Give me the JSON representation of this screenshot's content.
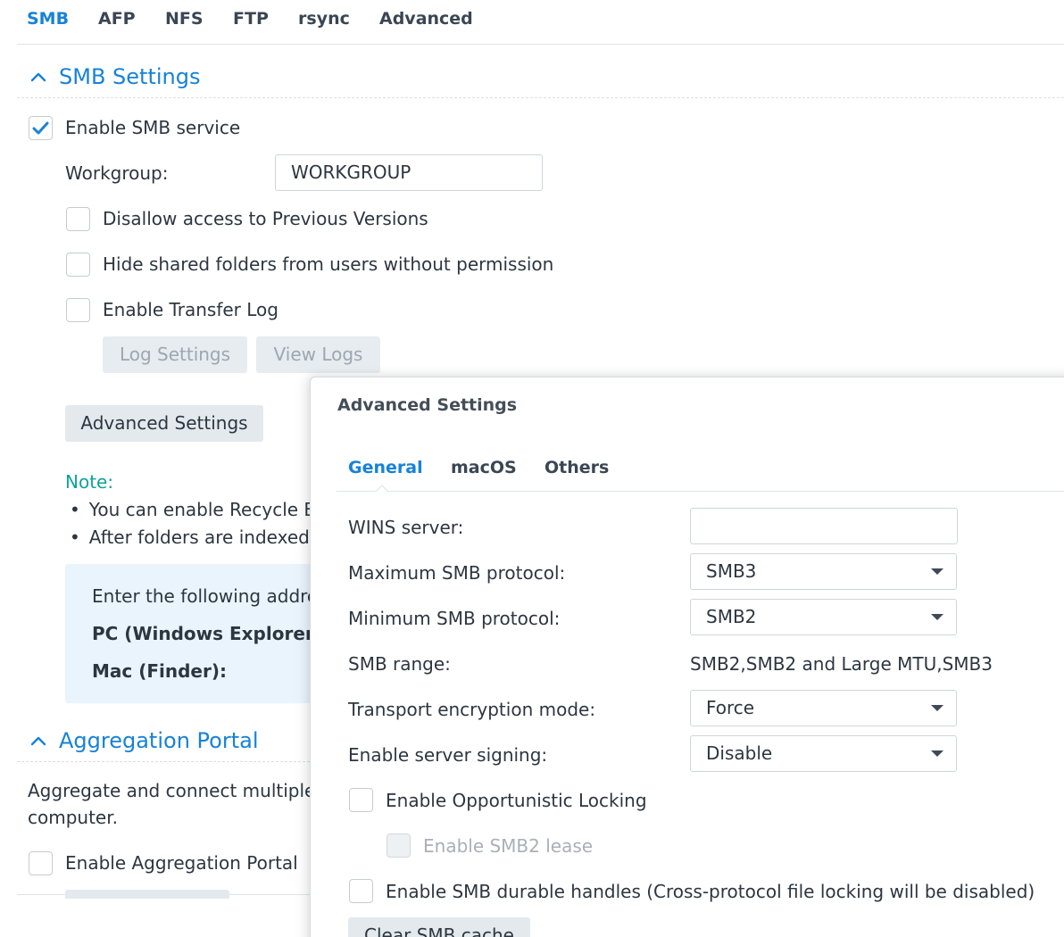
{
  "top_tabs": [
    {
      "label": "SMB",
      "active": true
    },
    {
      "label": "AFP",
      "active": false
    },
    {
      "label": "NFS",
      "active": false
    },
    {
      "label": "FTP",
      "active": false
    },
    {
      "label": "rsync",
      "active": false
    },
    {
      "label": "Advanced",
      "active": false
    }
  ],
  "smb_settings": {
    "title": "SMB Settings",
    "enable_smb_label": "Enable SMB service",
    "enable_smb_checked": true,
    "workgroup_label": "Workgroup:",
    "workgroup_value": "WORKGROUP",
    "disallow_prev_label": "Disallow access to Previous Versions",
    "hide_shared_label": "Hide shared folders from users without permission",
    "enable_transfer_log_label": "Enable Transfer Log",
    "log_settings_label": "Log Settings",
    "view_logs_label": "View Logs",
    "advanced_settings_label": "Advanced Settings",
    "note_title": "Note:",
    "note_bullets": [
      "You can enable Recycle Bi",
      "After folders are indexed"
    ],
    "info_text": "Enter the following addre",
    "pc_label": "PC (Windows Explorer",
    "mac_label": "Mac (Finder):"
  },
  "aggregation_portal": {
    "title": "Aggregation Portal",
    "desc_line1": "Aggregate and connect multiple",
    "desc_line2": "computer.",
    "enable_label": "Enable Aggregation Portal"
  },
  "modal": {
    "title": "Advanced Settings",
    "tabs": [
      {
        "label": "General",
        "active": true
      },
      {
        "label": "macOS",
        "active": false
      },
      {
        "label": "Others",
        "active": false
      }
    ],
    "wins_label": "WINS server:",
    "wins_value": "",
    "max_smb_label": "Maximum SMB protocol:",
    "max_smb_value": "SMB3",
    "min_smb_label": "Minimum SMB protocol:",
    "min_smb_value": "SMB2",
    "smb_range_label": "SMB range:",
    "smb_range_value": "SMB2,SMB2 and Large MTU,SMB3",
    "transport_label": "Transport encryption mode:",
    "transport_value": "Force",
    "signing_label": "Enable server signing:",
    "signing_value": "Disable",
    "oplock_label": "Enable Opportunistic Locking",
    "smb2_lease_label": "Enable SMB2 lease",
    "durable_label": "Enable SMB durable handles (Cross-protocol file locking will be disabled)",
    "clear_cache_label": "Clear SMB cache"
  },
  "colors": {
    "accent": "#1782d8",
    "note": "#10a39a",
    "info_box": "#e9f4fd"
  }
}
